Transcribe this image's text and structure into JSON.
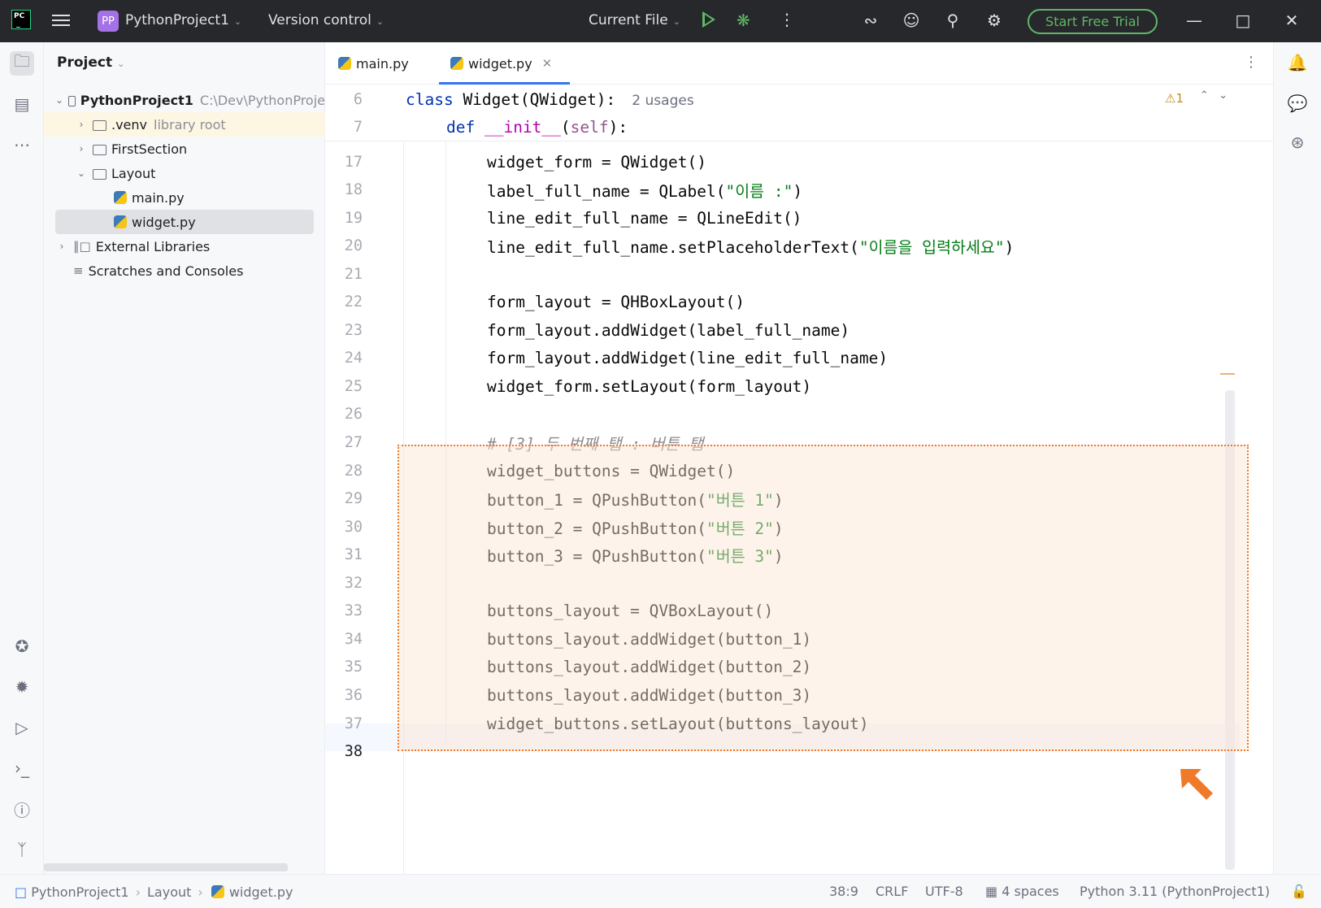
{
  "titlebar": {
    "project_badge": "PP",
    "project_name": "PythonProject1",
    "version_control": "Version control",
    "run_config": "Current File",
    "trial_button": "Start Free Trial"
  },
  "project_panel": {
    "title": "Project",
    "tree": [
      {
        "label": "PythonProject1",
        "extra": "C:\\Dev\\PythonProje"
      },
      {
        "label": ".venv",
        "extra": "library root"
      },
      {
        "label": "FirstSection"
      },
      {
        "label": "Layout"
      },
      {
        "label": "main.py"
      },
      {
        "label": "widget.py"
      },
      {
        "label": "External Libraries"
      },
      {
        "label": "Scratches and Consoles"
      }
    ]
  },
  "editor": {
    "tabs": [
      {
        "label": "main.py",
        "active": false
      },
      {
        "label": "widget.py",
        "active": true
      }
    ],
    "warning_count": "1",
    "sticky_lines": [
      {
        "number": "6",
        "text": "class Widget(QWidget):",
        "hint": "2 usages"
      },
      {
        "number": "7",
        "text": "def __init__(self):"
      }
    ],
    "lines": [
      {
        "number": "17",
        "text": "widget_form = QWidget()"
      },
      {
        "number": "18",
        "text": "label_full_name = QLabel(\"이름 :\")"
      },
      {
        "number": "19",
        "text": "line_edit_full_name = QLineEdit()"
      },
      {
        "number": "20",
        "text": "line_edit_full_name.setPlaceholderText(\"이름을 입력하세요\")"
      },
      {
        "number": "21",
        "text": ""
      },
      {
        "number": "22",
        "text": "form_layout = QHBoxLayout()"
      },
      {
        "number": "23",
        "text": "form_layout.addWidget(label_full_name)"
      },
      {
        "number": "24",
        "text": "form_layout.addWidget(line_edit_full_name)"
      },
      {
        "number": "25",
        "text": "widget_form.setLayout(form_layout)"
      },
      {
        "number": "26",
        "text": ""
      },
      {
        "number": "27",
        "text": "# [3] 두 번째 탭 : 버튼 탭"
      },
      {
        "number": "28",
        "text": "widget_buttons = QWidget()"
      },
      {
        "number": "29",
        "text": "button_1 = QPushButton(\"버튼 1\")"
      },
      {
        "number": "30",
        "text": "button_2 = QPushButton(\"버튼 2\")"
      },
      {
        "number": "31",
        "text": "button_3 = QPushButton(\"버튼 3\")"
      },
      {
        "number": "32",
        "text": ""
      },
      {
        "number": "33",
        "text": "buttons_layout = QVBoxLayout()"
      },
      {
        "number": "34",
        "text": "buttons_layout.addWidget(button_1)"
      },
      {
        "number": "35",
        "text": "buttons_layout.addWidget(button_2)"
      },
      {
        "number": "36",
        "text": "buttons_layout.addWidget(button_3)"
      },
      {
        "number": "37",
        "text": "widget_buttons.setLayout(buttons_layout)"
      },
      {
        "number": "38",
        "text": ""
      }
    ]
  },
  "statusbar": {
    "breadcrumb": [
      "PythonProject1",
      "Layout",
      "widget.py"
    ],
    "position": "38:9",
    "line_ending": "CRLF",
    "encoding": "UTF-8",
    "indent": "4 spaces",
    "interpreter": "Python 3.11 (PythonProject1)"
  },
  "colors": {
    "keyword": "#0033b3",
    "string": "#067d17",
    "comment": "#8c8c8c",
    "highlight_border": "#ef7a2a",
    "accent": "#3574f0",
    "trial_green": "#5fb865"
  },
  "icons": {
    "titlebar": [
      "pycharm-logo-icon",
      "hamburger-menu-icon",
      "run-icon",
      "debug-icon",
      "more-icon",
      "ai-assistant-icon",
      "add-user-icon",
      "search-icon",
      "settings-icon"
    ],
    "left_strip": [
      "folder-icon",
      "structure-icon",
      "more-tools-icon",
      "python-packages-icon",
      "python-console-icon",
      "services-icon",
      "terminal-icon",
      "problems-icon",
      "git-icon"
    ],
    "right_strip": [
      "notifications-icon",
      "ai-chat-icon",
      "plugins-icon"
    ]
  }
}
